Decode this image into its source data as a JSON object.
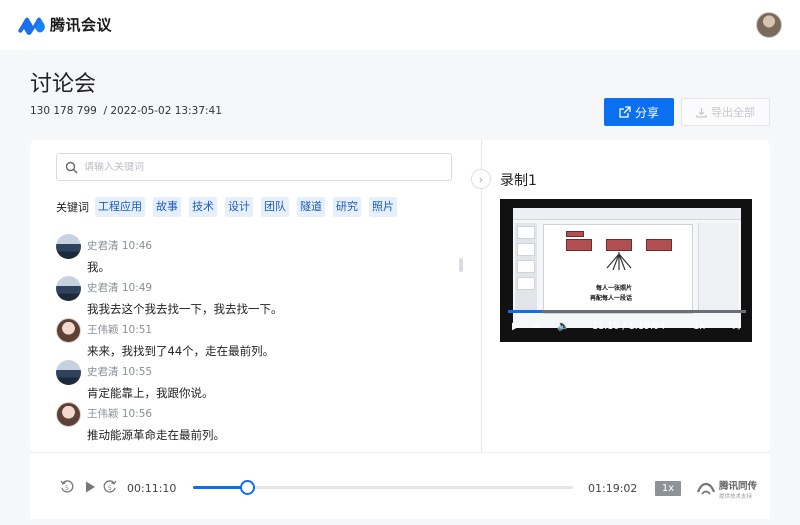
{
  "app": {
    "name": "腾讯会议"
  },
  "meeting": {
    "title": "讨论会",
    "id": "130 178 799",
    "datetime": "/ 2022-05-02 13:37:41",
    "share_label": "分享",
    "export_label": "导出全部"
  },
  "search": {
    "placeholder": "请输入关键词"
  },
  "keywords": {
    "label": "关键词",
    "tags": [
      "工程应用",
      "故事",
      "技术",
      "设计",
      "团队",
      "隧道",
      "研究",
      "照片"
    ]
  },
  "transcript": [
    {
      "speaker": "史君清",
      "time": "10:46",
      "text": "我。",
      "avatar": "mountain"
    },
    {
      "speaker": "史君清",
      "time": "10:49",
      "text": "我我去这个我去找一下，我去找一下。",
      "avatar": "mountain"
    },
    {
      "speaker": "王伟颖",
      "time": "10:51",
      "text": "来来，我找到了44个，走在最前列。",
      "avatar": "girl"
    },
    {
      "speaker": "史君清",
      "time": "10:55",
      "text": "肯定能靠上，我跟你说。",
      "avatar": "mountain"
    },
    {
      "speaker": "王伟颖",
      "time": "10:56",
      "text": "推动能源革命走在最前列。",
      "avatar": "girl"
    }
  ],
  "recording": {
    "title": "录制1",
    "video_time": "11:10 / 1:19:04",
    "video_speed": "1x",
    "video_progress": 0.141,
    "slide_line1": "每人一张照片",
    "slide_line2": "再配每人一段话"
  },
  "player": {
    "current_time": "00:11:10",
    "total_time": "01:19:02",
    "progress": 0.141,
    "speed": "1x",
    "brand_name": "腾讯同传",
    "brand_sub": "提供技术支持"
  },
  "colors": {
    "accent": "#0b6ff2",
    "tag_bg": "#e6f0fd",
    "tag_text": "#1d5bb8"
  }
}
